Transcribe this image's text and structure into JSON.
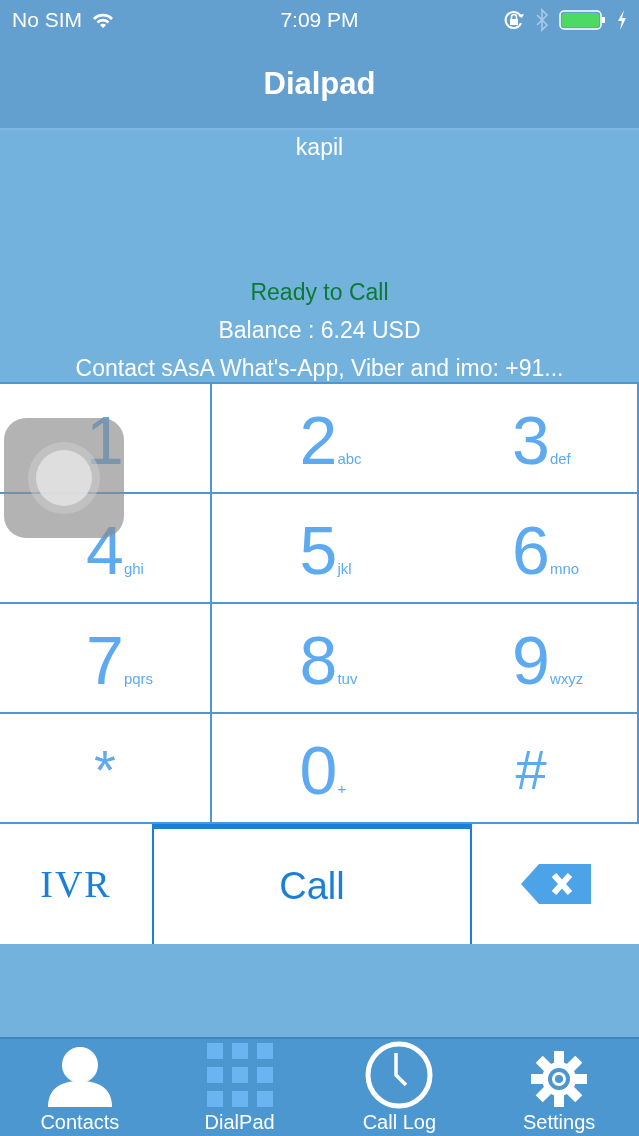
{
  "status_bar": {
    "carrier": "No SIM",
    "time": "7:09 PM"
  },
  "nav": {
    "title": "Dialpad"
  },
  "info": {
    "name": "kapil",
    "status": "Ready to Call",
    "balance": "Balance : 6.24 USD",
    "contact": "Contact sAsA What's-App, Viber and imo: +91..."
  },
  "keys": [
    {
      "digit": "1"
    },
    {
      "digit": "2",
      "letters": "abc"
    },
    {
      "digit": "3",
      "letters": "def"
    },
    {
      "digit": "4",
      "letters": "ghi"
    },
    {
      "digit": "5",
      "letters": "jkl"
    },
    {
      "digit": "6",
      "letters": "mno"
    },
    {
      "digit": "7",
      "letters": "pqrs"
    },
    {
      "digit": "8",
      "letters": "tuv"
    },
    {
      "digit": "9",
      "letters": "wxyz"
    },
    {
      "digit": "*"
    },
    {
      "digit": "0",
      "letters": "+"
    },
    {
      "digit": "#"
    }
  ],
  "actions": [
    {
      "kind": "ivr",
      "label": "IVR"
    },
    {
      "kind": "call",
      "label": "Call"
    },
    {
      "kind": "backspace"
    }
  ],
  "tabs": [
    {
      "kind": "contacts",
      "label": "Contacts",
      "selected": false
    },
    {
      "kind": "dialpad",
      "label": "DialPad",
      "selected": true
    },
    {
      "kind": "clock",
      "label": "Call Log",
      "selected": false
    },
    {
      "kind": "settings",
      "label": "Settings",
      "selected": false
    }
  ]
}
